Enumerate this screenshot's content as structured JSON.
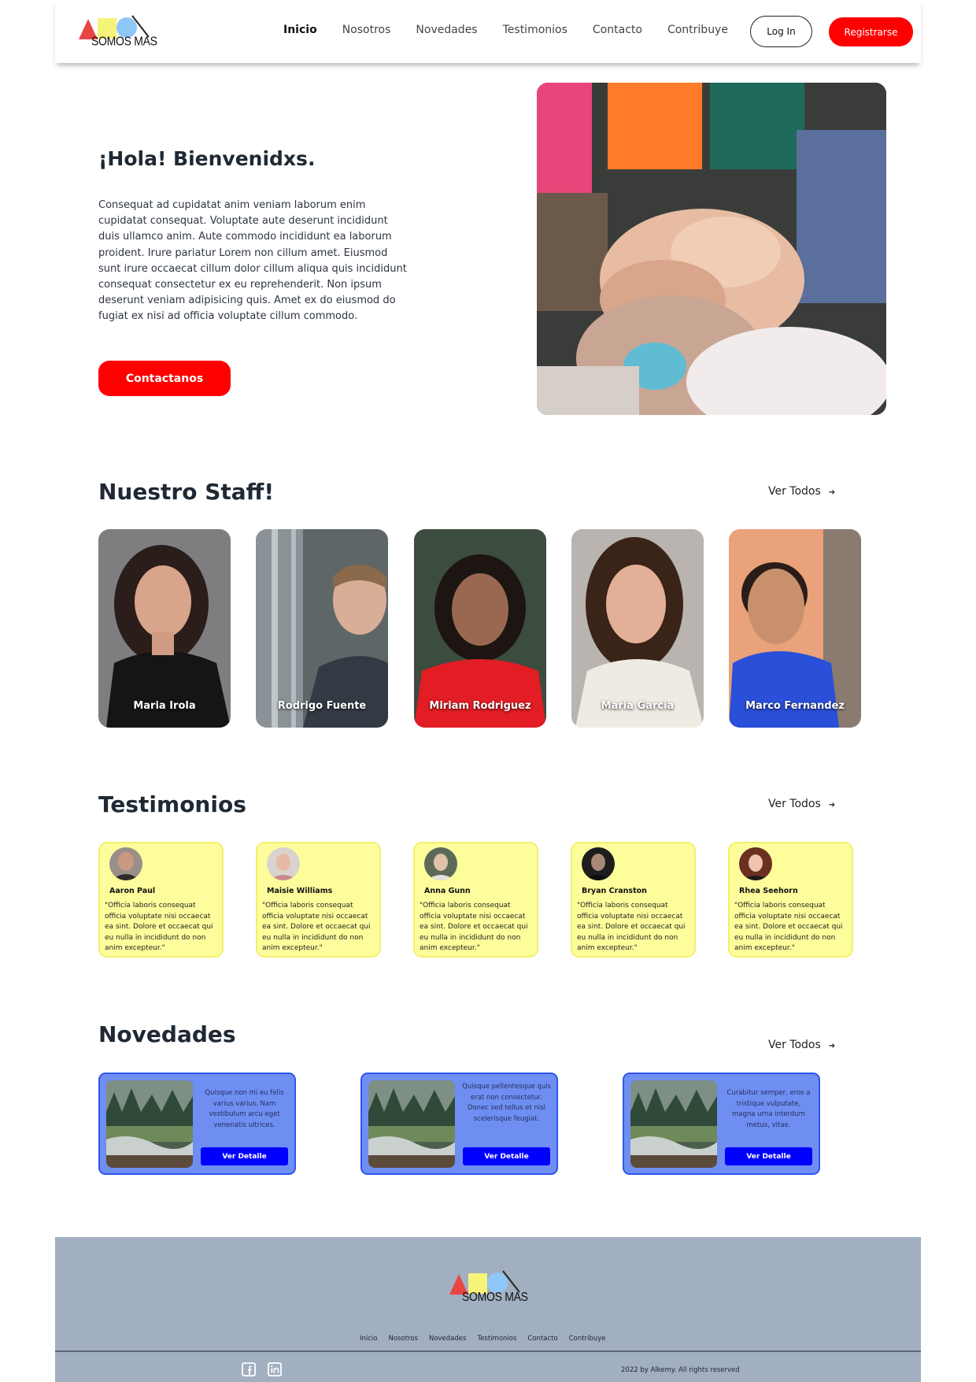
{
  "brand": {
    "logo_text": "SOMOS MAS"
  },
  "nav": {
    "items": [
      "Inicio",
      "Nosotros",
      "Novedades",
      "Testimonios",
      "Contacto",
      "Contribuye"
    ],
    "active": "Inicio"
  },
  "header": {
    "login_label": "Log In",
    "register_label": "Registrarse"
  },
  "hero": {
    "title": "¡Hola! Bienvenidxs.",
    "text": "Consequat ad cupidatat anim veniam laborum enim cupidatat consequat. Voluptate aute deserunt incididunt duis ullamco anim. Aute commodo incididunt ea laborum proident. Irure pariatur Lorem non cillum amet. Eiusmod sunt irure occaecat cillum dolor cillum aliqua quis incididunt consequat consectetur ex eu reprehenderit. Non ipsum deserunt veniam adipisicing quis. Amet ex do eiusmod do fugiat ex nisi ad officia voluptate cillum commodo.",
    "button_label": "Contactanos"
  },
  "staff": {
    "title": "Nuestro Staff!",
    "ver_todos": "Ver Todos",
    "members": [
      {
        "name": "Maria Irola"
      },
      {
        "name": "Rodrigo Fuente"
      },
      {
        "name": "Miriam Rodriguez"
      },
      {
        "name": "Maria Garcia"
      },
      {
        "name": "Marco Fernandez"
      }
    ]
  },
  "testimonials": {
    "title": "Testimonios",
    "ver_todos": "Ver Todos",
    "items": [
      {
        "name": "Aaron Paul",
        "text": "\"Officia laboris consequat officia voluptate nisi occaecat ea sint. Dolore et occaecat qui eu nulla in incididunt do non anim excepteur.\""
      },
      {
        "name": "Maisie Williams",
        "text": "\"Officia laboris consequat officia voluptate nisi occaecat ea sint. Dolore et occaecat qui eu nulla in incididunt do non anim excepteur.\""
      },
      {
        "name": "Anna Gunn",
        "text": "\"Officia laboris consequat officia voluptate nisi occaecat ea sint. Dolore et occaecat qui eu nulla in incididunt do non anim excepteur.\""
      },
      {
        "name": "Bryan Cranston",
        "text": "\"Officia laboris consequat officia voluptate nisi occaecat ea sint. Dolore et occaecat qui eu nulla in incididunt do non anim excepteur.\""
      },
      {
        "name": "Rhea Seehorn",
        "text": "\"Officia laboris consequat officia voluptate nisi occaecat ea sint. Dolore et occaecat qui eu nulla in incididunt do non anim excepteur.\""
      }
    ]
  },
  "news": {
    "title": "Novedades",
    "ver_todos": "Ver Todos",
    "items": [
      {
        "text": "Quisque non mi eu felis varius varius. Nam vestibulum arcu eget venenatis ultrices.",
        "button_label": "Ver Detalle"
      },
      {
        "text": "Quisque pellentesque quis erat non consectetur. Donec sed tellus et nisl scelerisque feugiat.",
        "button_label": "Ver Detalle"
      },
      {
        "text": "Curabitur semper, eros a tristique vulputate, magna urna interdum metus, vitae.",
        "button_label": "Ver Detalle"
      }
    ]
  },
  "footer": {
    "nav": [
      "Inicio",
      "Nosotros",
      "Novedades",
      "Testimonios",
      "Contacto",
      "Contribuye"
    ],
    "copyright": "2022 by Alkemy. All rights reserved"
  },
  "colors": {
    "accent_red": "#ff0000",
    "testimonial_bg": "#fdfd9c",
    "news_bg": "#6f8ef2",
    "news_button": "#0000ff",
    "footer_bg": "#a2afc0"
  },
  "icons": [
    "facebook-icon",
    "linkedin-icon",
    "arrow-right-icon"
  ]
}
